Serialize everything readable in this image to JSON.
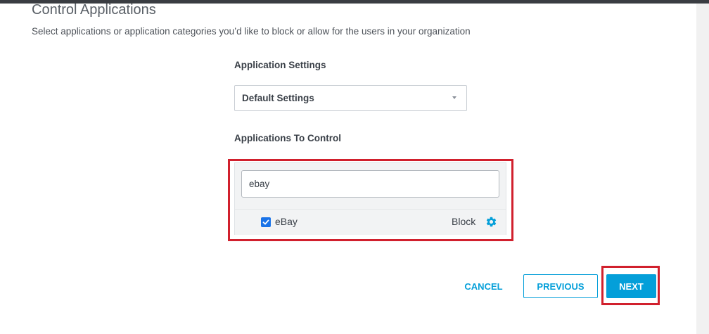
{
  "page": {
    "title": "Control Applications",
    "description": "Select applications or application categories you’d like to block or allow for the users in your organization"
  },
  "settings": {
    "label": "Application Settings",
    "selected": "Default Settings"
  },
  "apps": {
    "label": "Applications To Control",
    "search_value": "ebay",
    "results": [
      {
        "name": "eBay",
        "checked": true,
        "action": "Block",
        "icon": "gear-icon"
      }
    ]
  },
  "footer": {
    "cancel_label": "CANCEL",
    "previous_label": "PREVIOUS",
    "next_label": "NEXT"
  },
  "colors": {
    "accent": "#049fd9",
    "highlight": "#d1202d",
    "checkbox": "#1a73e8"
  }
}
